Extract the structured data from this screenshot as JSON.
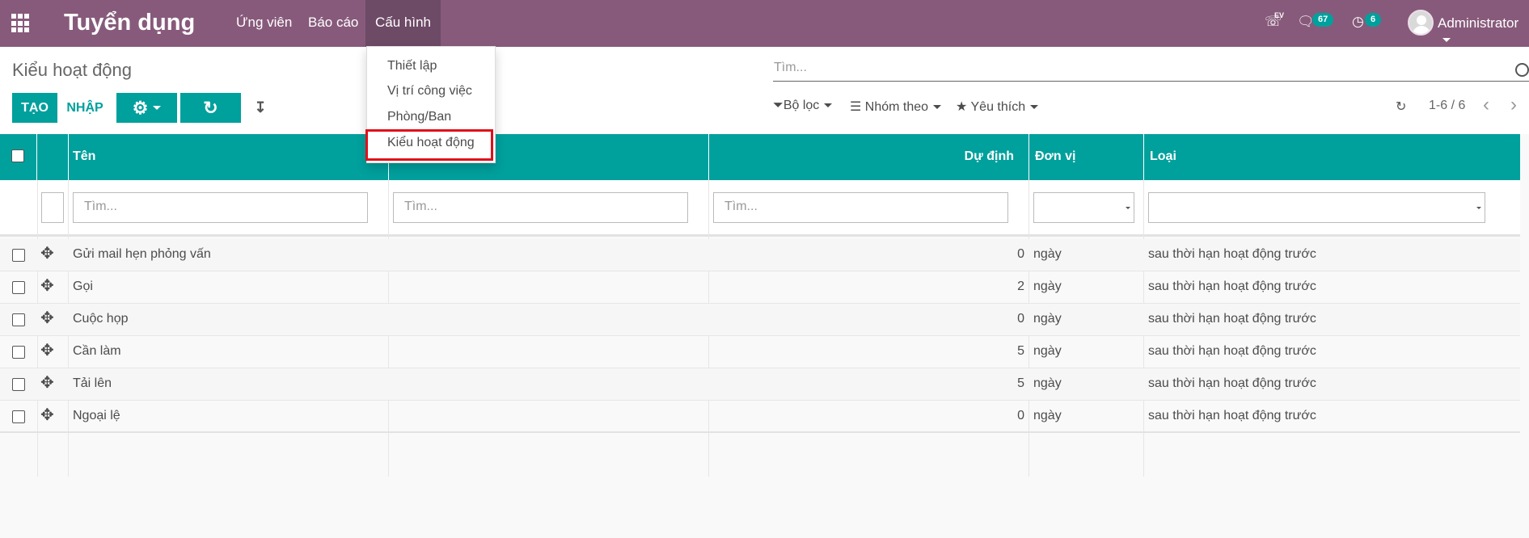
{
  "nav": {
    "app_title": "Tuyển dụng",
    "menu": [
      "Ứng viên",
      "Báo cáo",
      "Cấu hình"
    ],
    "phone_label": "EV",
    "messages_count": "67",
    "activities_count": "6",
    "user": "Administrator"
  },
  "control": {
    "breadcrumb": "Kiểu hoạt động",
    "create": "TẠO",
    "import": "NHẬP",
    "search_placeholder": "Tìm...",
    "filters": "Bộ lọc",
    "group_by": "Nhóm theo",
    "favorites": "Yêu thích",
    "pager": "1-6 / 6"
  },
  "dropdown": {
    "items": [
      "Thiết lập",
      "Vị trí công việc",
      "Phòng/Ban",
      "Kiểu hoạt động"
    ]
  },
  "table": {
    "headers": [
      "Tên",
      "",
      "Dự định",
      "Đơn vị",
      "Loại"
    ],
    "filter_placeholder": "Tìm...",
    "rows": [
      {
        "name": "Gửi mail hẹn phỏng vấn",
        "planned": "0",
        "unit": "ngày",
        "type": "sau thời hạn hoạt động trước"
      },
      {
        "name": "Gọi",
        "planned": "2",
        "unit": "ngày",
        "type": "sau thời hạn hoạt động trước"
      },
      {
        "name": "Cuộc họp",
        "planned": "0",
        "unit": "ngày",
        "type": "sau thời hạn hoạt động trước"
      },
      {
        "name": "Cần làm",
        "planned": "5",
        "unit": "ngày",
        "type": "sau thời hạn hoạt động trước"
      },
      {
        "name": "Tải lên",
        "planned": "5",
        "unit": "ngày",
        "type": "sau thời hạn hoạt động trước"
      },
      {
        "name": "Ngoại lệ",
        "planned": "0",
        "unit": "ngày",
        "type": "sau thời hạn hoạt động trước"
      }
    ]
  },
  "colors": {
    "brand": "#875a7b",
    "accent": "#00a09d",
    "highlight": "#e0101a"
  }
}
